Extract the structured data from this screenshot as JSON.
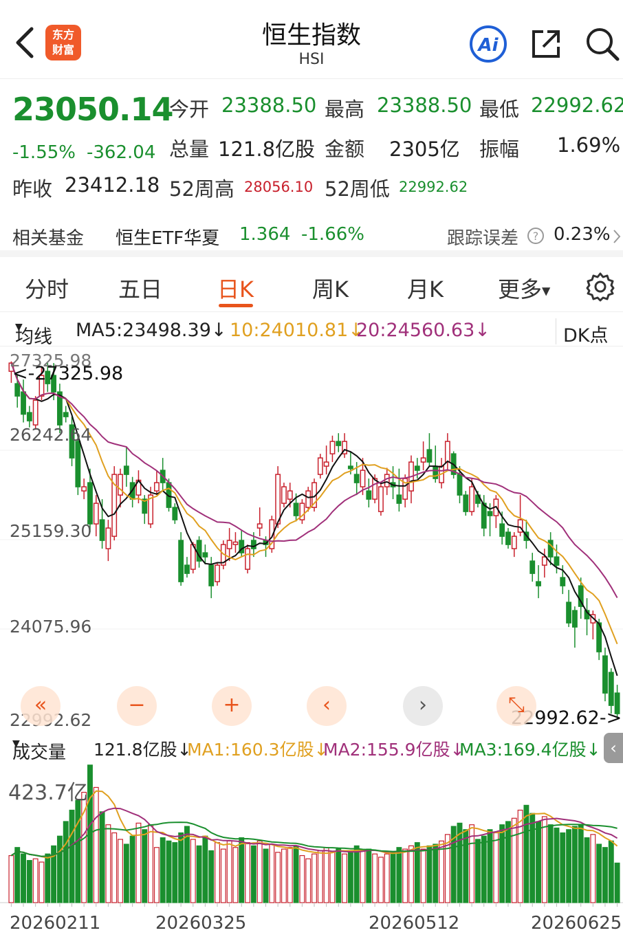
{
  "header": {
    "back_icon": "chevron-left-icon",
    "logo_text": "东方财富",
    "title": "恒生指数",
    "subtitle": "HSI",
    "ai_label": "Ai",
    "share_icon": "share-icon",
    "search_icon": "search-icon"
  },
  "quote": {
    "price": "23050.14",
    "change_pct": "-1.55%",
    "change": "-362.04",
    "prev_close_label": "昨收",
    "prev_close": "23412.18",
    "open_label": "今开",
    "open": "23388.50",
    "high_label": "最高",
    "high": "23388.50",
    "low_label": "最低",
    "low": "22992.62",
    "volume_label": "总量",
    "volume": "121.8亿股",
    "amount_label": "金额",
    "amount": "2305亿",
    "amplitude_label": "振幅",
    "amplitude": "1.69%",
    "w52_high_label": "52周高",
    "w52_high": "28056.10",
    "w52_low_label": "52周低",
    "w52_low": "22992.62"
  },
  "fund": {
    "label": "相关基金",
    "name": "恒生ETF华夏",
    "price": "1.364",
    "change": "-1.66%",
    "tracking_label": "跟踪误差",
    "tracking_value": "0.23%"
  },
  "tabs": [
    {
      "label": "分时"
    },
    {
      "label": "五日"
    },
    {
      "label": "日K"
    },
    {
      "label": "周K"
    },
    {
      "label": "月K"
    },
    {
      "label": "更多"
    }
  ],
  "ma": {
    "selector": "均线",
    "ma5": "MA5:23498.39↓",
    "ma10": "10:24010.81↓",
    "ma20": "20:24560.63↓",
    "dk": "DK点"
  },
  "vol_header": {
    "selector": "成交量",
    "vol": "121.8亿股↓",
    "ma1": "MA1:160.3亿股↓",
    "ma2": "MA2:155.9亿股↓",
    "ma3": "MA3:169.4亿股↓"
  },
  "colors": {
    "up": "#c8202c",
    "down": "#1a8f2e",
    "ma5": "#111111",
    "ma10": "#e0a020",
    "ma20": "#a0307a",
    "accent": "#e8541c"
  },
  "chart_data": {
    "type": "candlestick",
    "y_ticks": [
      "27325.98",
      "26242.64",
      "25159.30",
      "24075.96",
      "22992.62"
    ],
    "ylim": [
      22992.62,
      27325.98
    ],
    "max_marker": "<-27325.98",
    "min_marker": "22992.62->",
    "x_ticks": [
      "20260211",
      "20260325",
      "20260512",
      "20260625"
    ],
    "volume_max_label": "423.7亿",
    "candles": [
      [
        27200,
        27320,
        27060,
        27300
      ],
      [
        27050,
        27150,
        26760,
        26900
      ],
      [
        26950,
        27100,
        26580,
        26680
      ],
      [
        26700,
        26780,
        26520,
        26600
      ],
      [
        26550,
        26900,
        26500,
        26850
      ],
      [
        26900,
        27250,
        26850,
        27150
      ],
      [
        27200,
        27300,
        26950,
        27050
      ],
      [
        27150,
        27300,
        26850,
        26950
      ],
      [
        26950,
        27050,
        26450,
        26550
      ],
      [
        26700,
        26780,
        26580,
        26650
      ],
      [
        26550,
        26650,
        26050,
        26150
      ],
      [
        26350,
        26420,
        25700,
        25800
      ],
      [
        25750,
        25900,
        25650,
        25800
      ],
      [
        25850,
        26020,
        25250,
        25350
      ],
      [
        25350,
        25700,
        25200,
        25600
      ],
      [
        25400,
        25650,
        25050,
        25150
      ],
      [
        25050,
        25400,
        24900,
        25300
      ],
      [
        25200,
        26050,
        25150,
        25950
      ],
      [
        25700,
        26020,
        25550,
        25950
      ],
      [
        26050,
        26280,
        25800,
        25950
      ],
      [
        25850,
        25920,
        25550,
        25650
      ],
      [
        25700,
        26000,
        25600,
        25880
      ],
      [
        25650,
        25700,
        25350,
        25480
      ],
      [
        25350,
        25800,
        25300,
        25700
      ],
      [
        25750,
        26000,
        25700,
        25850
      ],
      [
        26000,
        26150,
        25750,
        25850
      ],
      [
        25850,
        25900,
        25500,
        25550
      ],
      [
        25550,
        25600,
        25350,
        25400
      ],
      [
        25150,
        25250,
        24600,
        24650
      ],
      [
        24850,
        24950,
        24700,
        24750
      ],
      [
        24800,
        25130,
        24750,
        25100
      ],
      [
        25150,
        25200,
        24820,
        24900
      ],
      [
        25000,
        25100,
        24860,
        24950
      ],
      [
        24850,
        24950,
        24450,
        24600
      ],
      [
        24650,
        24880,
        24600,
        24850
      ],
      [
        24850,
        25150,
        24800,
        25100
      ],
      [
        25050,
        25300,
        24900,
        25150
      ],
      [
        25100,
        25250,
        25000,
        25130
      ],
      [
        25150,
        25280,
        24950,
        25000
      ],
      [
        24800,
        25100,
        24750,
        25050
      ],
      [
        25150,
        25250,
        24950,
        25050
      ],
      [
        25300,
        25550,
        25200,
        25350
      ],
      [
        25150,
        25200,
        24950,
        25100
      ],
      [
        25050,
        25450,
        25000,
        25400
      ],
      [
        25350,
        26050,
        25300,
        25950
      ],
      [
        25600,
        25850,
        25550,
        25800
      ],
      [
        25650,
        25850,
        25550,
        25750
      ],
      [
        25600,
        25720,
        25380,
        25450
      ],
      [
        25400,
        25650,
        25350,
        25600
      ],
      [
        25550,
        25800,
        25500,
        25750
      ],
      [
        25550,
        25900,
        25500,
        25850
      ],
      [
        25950,
        26200,
        25900,
        26150
      ],
      [
        26050,
        26300,
        25950,
        26100
      ],
      [
        26200,
        26420,
        26100,
        26350
      ],
      [
        26350,
        26450,
        26220,
        26300
      ],
      [
        26200,
        26450,
        26150,
        26350
      ],
      [
        26050,
        26230,
        25950,
        26020
      ],
      [
        25950,
        26100,
        25700,
        25850
      ],
      [
        25800,
        26150,
        25700,
        26000
      ],
      [
        25750,
        25900,
        25550,
        25650
      ],
      [
        25650,
        25950,
        25600,
        25900
      ],
      [
        25500,
        25850,
        25450,
        25800
      ],
      [
        25800,
        26030,
        25700,
        25950
      ],
      [
        25850,
        26050,
        25650,
        25800
      ],
      [
        25700,
        26020,
        25500,
        25600
      ],
      [
        25650,
        25950,
        25550,
        25900
      ],
      [
        25750,
        26180,
        25600,
        26100
      ],
      [
        26050,
        26150,
        25900,
        26000
      ],
      [
        26100,
        26350,
        26000,
        26150
      ],
      [
        26250,
        26450,
        26050,
        26100
      ],
      [
        26050,
        26300,
        25850,
        25900
      ],
      [
        25850,
        26150,
        25780,
        26050
      ],
      [
        26100,
        26450,
        26000,
        26350
      ],
      [
        26200,
        26230,
        25900,
        25950
      ],
      [
        25950,
        26050,
        25600,
        25700
      ],
      [
        25700,
        25750,
        25450,
        25500
      ],
      [
        25500,
        25900,
        25450,
        25800
      ],
      [
        25700,
        25750,
        25550,
        25600
      ],
      [
        25600,
        25700,
        25200,
        25300
      ],
      [
        25500,
        25600,
        25200,
        25450
      ],
      [
        25450,
        25700,
        25300,
        25650
      ],
      [
        25350,
        25500,
        25100,
        25200
      ],
      [
        25250,
        25300,
        25050,
        25100
      ],
      [
        25050,
        25250,
        24950,
        25200
      ],
      [
        25250,
        25700,
        25200,
        25400
      ],
      [
        25250,
        25400,
        25050,
        25150
      ],
      [
        24900,
        25000,
        24650,
        24750
      ],
      [
        24650,
        24850,
        24450,
        24600
      ],
      [
        24850,
        25050,
        24700,
        24950
      ],
      [
        25150,
        25250,
        24850,
        24950
      ],
      [
        24950,
        25100,
        24750,
        24850
      ],
      [
        24700,
        24850,
        24500,
        24600
      ],
      [
        24400,
        24550,
        24100,
        24150
      ],
      [
        24300,
        24350,
        23850,
        24100
      ],
      [
        24600,
        24700,
        24200,
        24350
      ],
      [
        24300,
        24450,
        24000,
        24200
      ],
      [
        24150,
        24300,
        23950,
        24250
      ],
      [
        24150,
        24200,
        23700,
        23800
      ],
      [
        23750,
        23850,
        23200,
        23300
      ],
      [
        23550,
        23600,
        23050,
        23150
      ],
      [
        23300,
        23400,
        22993,
        23050
      ]
    ],
    "volumes": [
      145,
      170,
      150,
      130,
      135,
      125,
      150,
      175,
      205,
      250,
      285,
      315,
      340,
      424,
      355,
      280,
      240,
      215,
      195,
      180,
      205,
      245,
      225,
      240,
      170,
      200,
      190,
      185,
      215,
      235,
      195,
      175,
      205,
      160,
      185,
      165,
      190,
      170,
      200,
      185,
      175,
      190,
      165,
      180,
      155,
      165,
      170,
      175,
      145,
      135,
      150,
      160,
      170,
      155,
      165,
      150,
      160,
      175,
      160,
      165,
      150,
      140,
      150,
      155,
      170,
      165,
      175,
      185,
      165,
      175,
      180,
      190,
      210,
      235,
      245,
      225,
      240,
      195,
      205,
      225,
      215,
      240,
      250,
      260,
      285,
      300,
      275,
      250,
      265,
      240,
      230,
      215,
      225,
      235,
      240,
      200,
      210,
      180,
      170,
      190,
      122
    ],
    "volume_ylim": [
      0,
      423.7
    ]
  }
}
